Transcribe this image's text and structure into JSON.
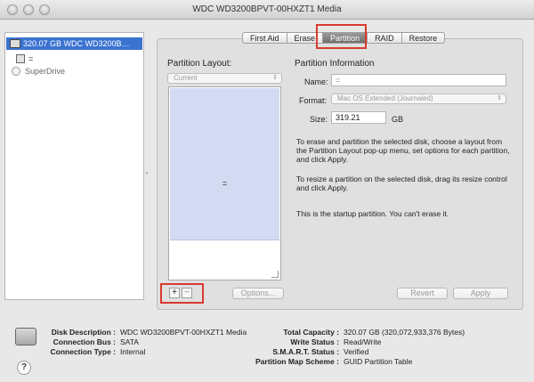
{
  "window": {
    "title": "WDC WD3200BPVT-00HXZT1 Media"
  },
  "sidebar": {
    "disk_label": "320.07 GB WDC WD3200B…",
    "volume_label": "=",
    "superdrive_label": "SuperDrive"
  },
  "tabs": [
    {
      "label": "First Aid"
    },
    {
      "label": "Erase"
    },
    {
      "label": "Partition"
    },
    {
      "label": "RAID"
    },
    {
      "label": "Restore"
    }
  ],
  "partition_layout": {
    "heading": "Partition Layout:",
    "popup_value": "Current",
    "partition_name": "="
  },
  "partition_info": {
    "heading": "Partition Information",
    "name_label": "Name:",
    "name_value": "=",
    "format_label": "Format:",
    "format_value": "Mac OS Extended (Journaled)",
    "size_label": "Size:",
    "size_value": "319.21",
    "size_unit": "GB",
    "text1": "To erase and partition the selected disk, choose a layout from the Partition Layout pop-up menu, set options for each partition, and click Apply.",
    "text2": "To resize a partition on the selected disk, drag its resize control and click Apply.",
    "text3": "This is the startup partition. You can't erase it."
  },
  "buttons": {
    "plus": "+",
    "minus": "−",
    "options": "Options...",
    "revert": "Revert",
    "apply": "Apply"
  },
  "footer": {
    "disk_description_label": "Disk Description :",
    "disk_description_value": "WDC WD3200BPVT-00HXZT1 Media",
    "connection_bus_label": "Connection Bus :",
    "connection_bus_value": "SATA",
    "connection_type_label": "Connection Type :",
    "connection_type_value": "Internal",
    "total_capacity_label": "Total Capacity :",
    "total_capacity_value": "320.07 GB (320,072,933,376 Bytes)",
    "write_status_label": "Write Status :",
    "write_status_value": "Read/Write",
    "smart_status_label": "S.M.A.R.T. Status :",
    "smart_status_value": "Verified",
    "partition_map_label": "Partition Map Scheme :",
    "partition_map_value": "GUID Partition Table",
    "help": "?"
  },
  "colors": {
    "selection": "#3b73d1",
    "highlight": "#d93a30",
    "partition_fill": "#d3dbf3"
  }
}
